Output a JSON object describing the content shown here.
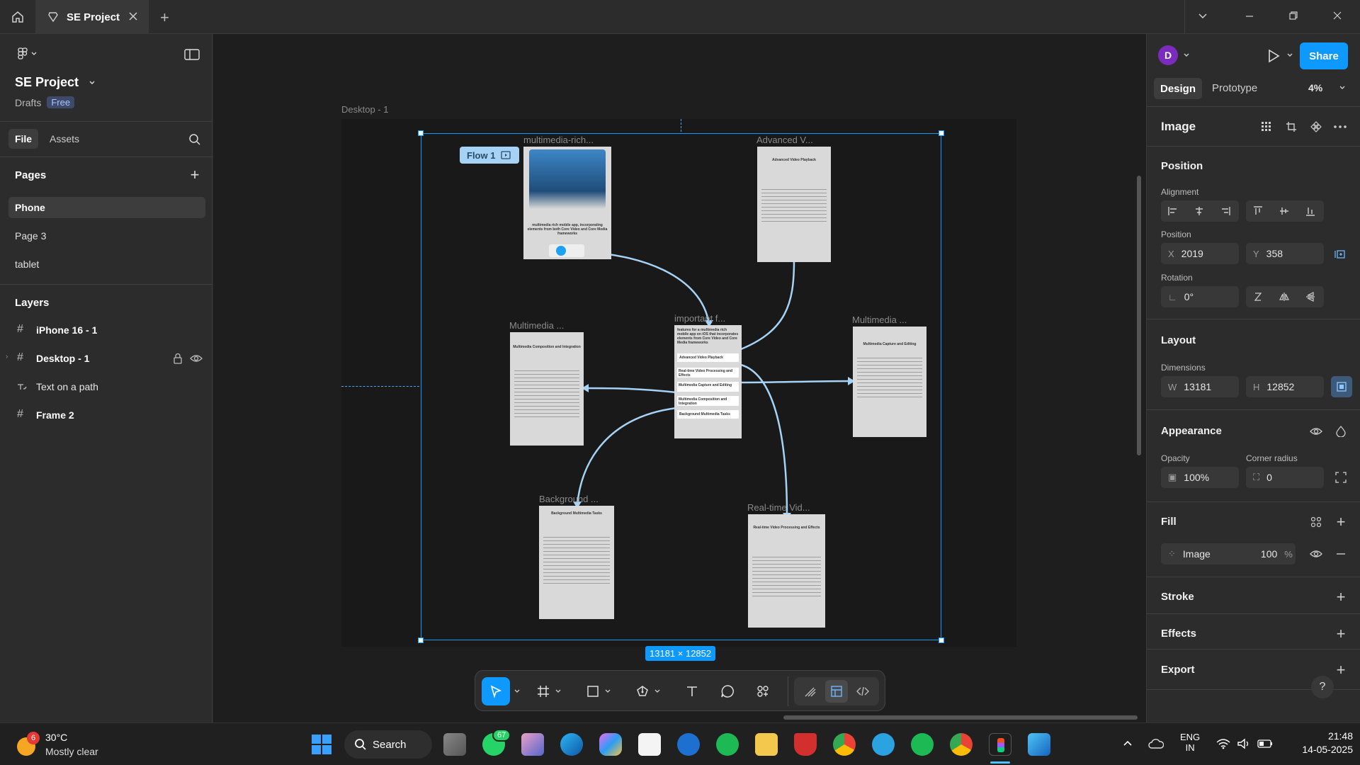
{
  "titlebar": {
    "tab_title": "SE Project"
  },
  "file": {
    "project_name": "SE Project",
    "location": "Drafts",
    "plan_badge": "Free",
    "tabs": [
      "File",
      "Assets"
    ]
  },
  "pages": {
    "heading": "Pages",
    "items": [
      "Phone",
      "Page 3",
      "tablet"
    ],
    "selected": "Phone"
  },
  "layers": {
    "heading": "Layers",
    "items": [
      "iPhone 16 - 1",
      "Desktop - 1",
      "Text on a path",
      "Frame 2"
    ]
  },
  "canvas": {
    "frame_label": "Desktop - 1",
    "flow_label": "Flow 1",
    "selection_size": "13181 × 12852",
    "cards": {
      "c1": {
        "title": "multimedia-rich...",
        "text": "multimedia rich mobile app, incorporating elements from both Core Video and Core Media frameworks"
      },
      "c2": {
        "title": "Advanced V...",
        "text": "Advanced Video Playback"
      },
      "c3": {
        "title": "Multimedia ...",
        "text": "Multimedia Composition and Integration"
      },
      "c4": {
        "title": "important f...",
        "text": "features for a multimedia rich mobile app on iOS that incorporates elements from Core Video and Core Media frameworks"
      },
      "c5": {
        "title": "Multimedia ...",
        "text": "Multimedia Capture and Editing"
      },
      "c6": {
        "title": "Background ...",
        "text": "Background Multimedia Tasks"
      },
      "c7": {
        "title": "Real-time Vid...",
        "text": "Real-time Video Processing and Effects"
      }
    },
    "menu_items": [
      "Advanced Video Playback",
      "Real-time Video Processing and Effects",
      "Multimedia Capture and Editing",
      "Multimedia Composition and Integration",
      "Background Multimedia Tasks"
    ]
  },
  "rightpanel": {
    "avatar_initial": "D",
    "share_label": "Share",
    "tabs": [
      "Design",
      "Prototype"
    ],
    "zoom": "4%",
    "object_type": "Image",
    "position_heading": "Position",
    "alignment_label": "Alignment",
    "position_label": "Position",
    "x_label": "X",
    "x_value": "2019",
    "y_label": "Y",
    "y_value": "358",
    "rotation_label": "Rotation",
    "rotation_value": "0°",
    "layout_heading": "Layout",
    "dimensions_label": "Dimensions",
    "w_label": "W",
    "w_value": "13181",
    "h_label": "H",
    "h_value": "12852",
    "appearance_heading": "Appearance",
    "opacity_label": "Opacity",
    "opacity_value": "100%",
    "radius_label": "Corner radius",
    "radius_value": "0",
    "fill_heading": "Fill",
    "fill_type": "Image",
    "fill_opacity": "100",
    "fill_unit": "%",
    "stroke_heading": "Stroke",
    "effects_heading": "Effects",
    "export_heading": "Export"
  },
  "taskbar": {
    "weather_temp": "30°C",
    "weather_desc": "Mostly clear",
    "weather_badge": "6",
    "search_label": "Search",
    "whatsapp_badge": "67",
    "lang1": "ENG",
    "lang2": "IN",
    "time": "21:48",
    "date": "14-05-2025"
  },
  "colors": {
    "accent": "#0d99ff",
    "panel_bg": "#2c2c2c",
    "canvas_bg": "#1e1e1e",
    "frame_bg": "#191919"
  }
}
